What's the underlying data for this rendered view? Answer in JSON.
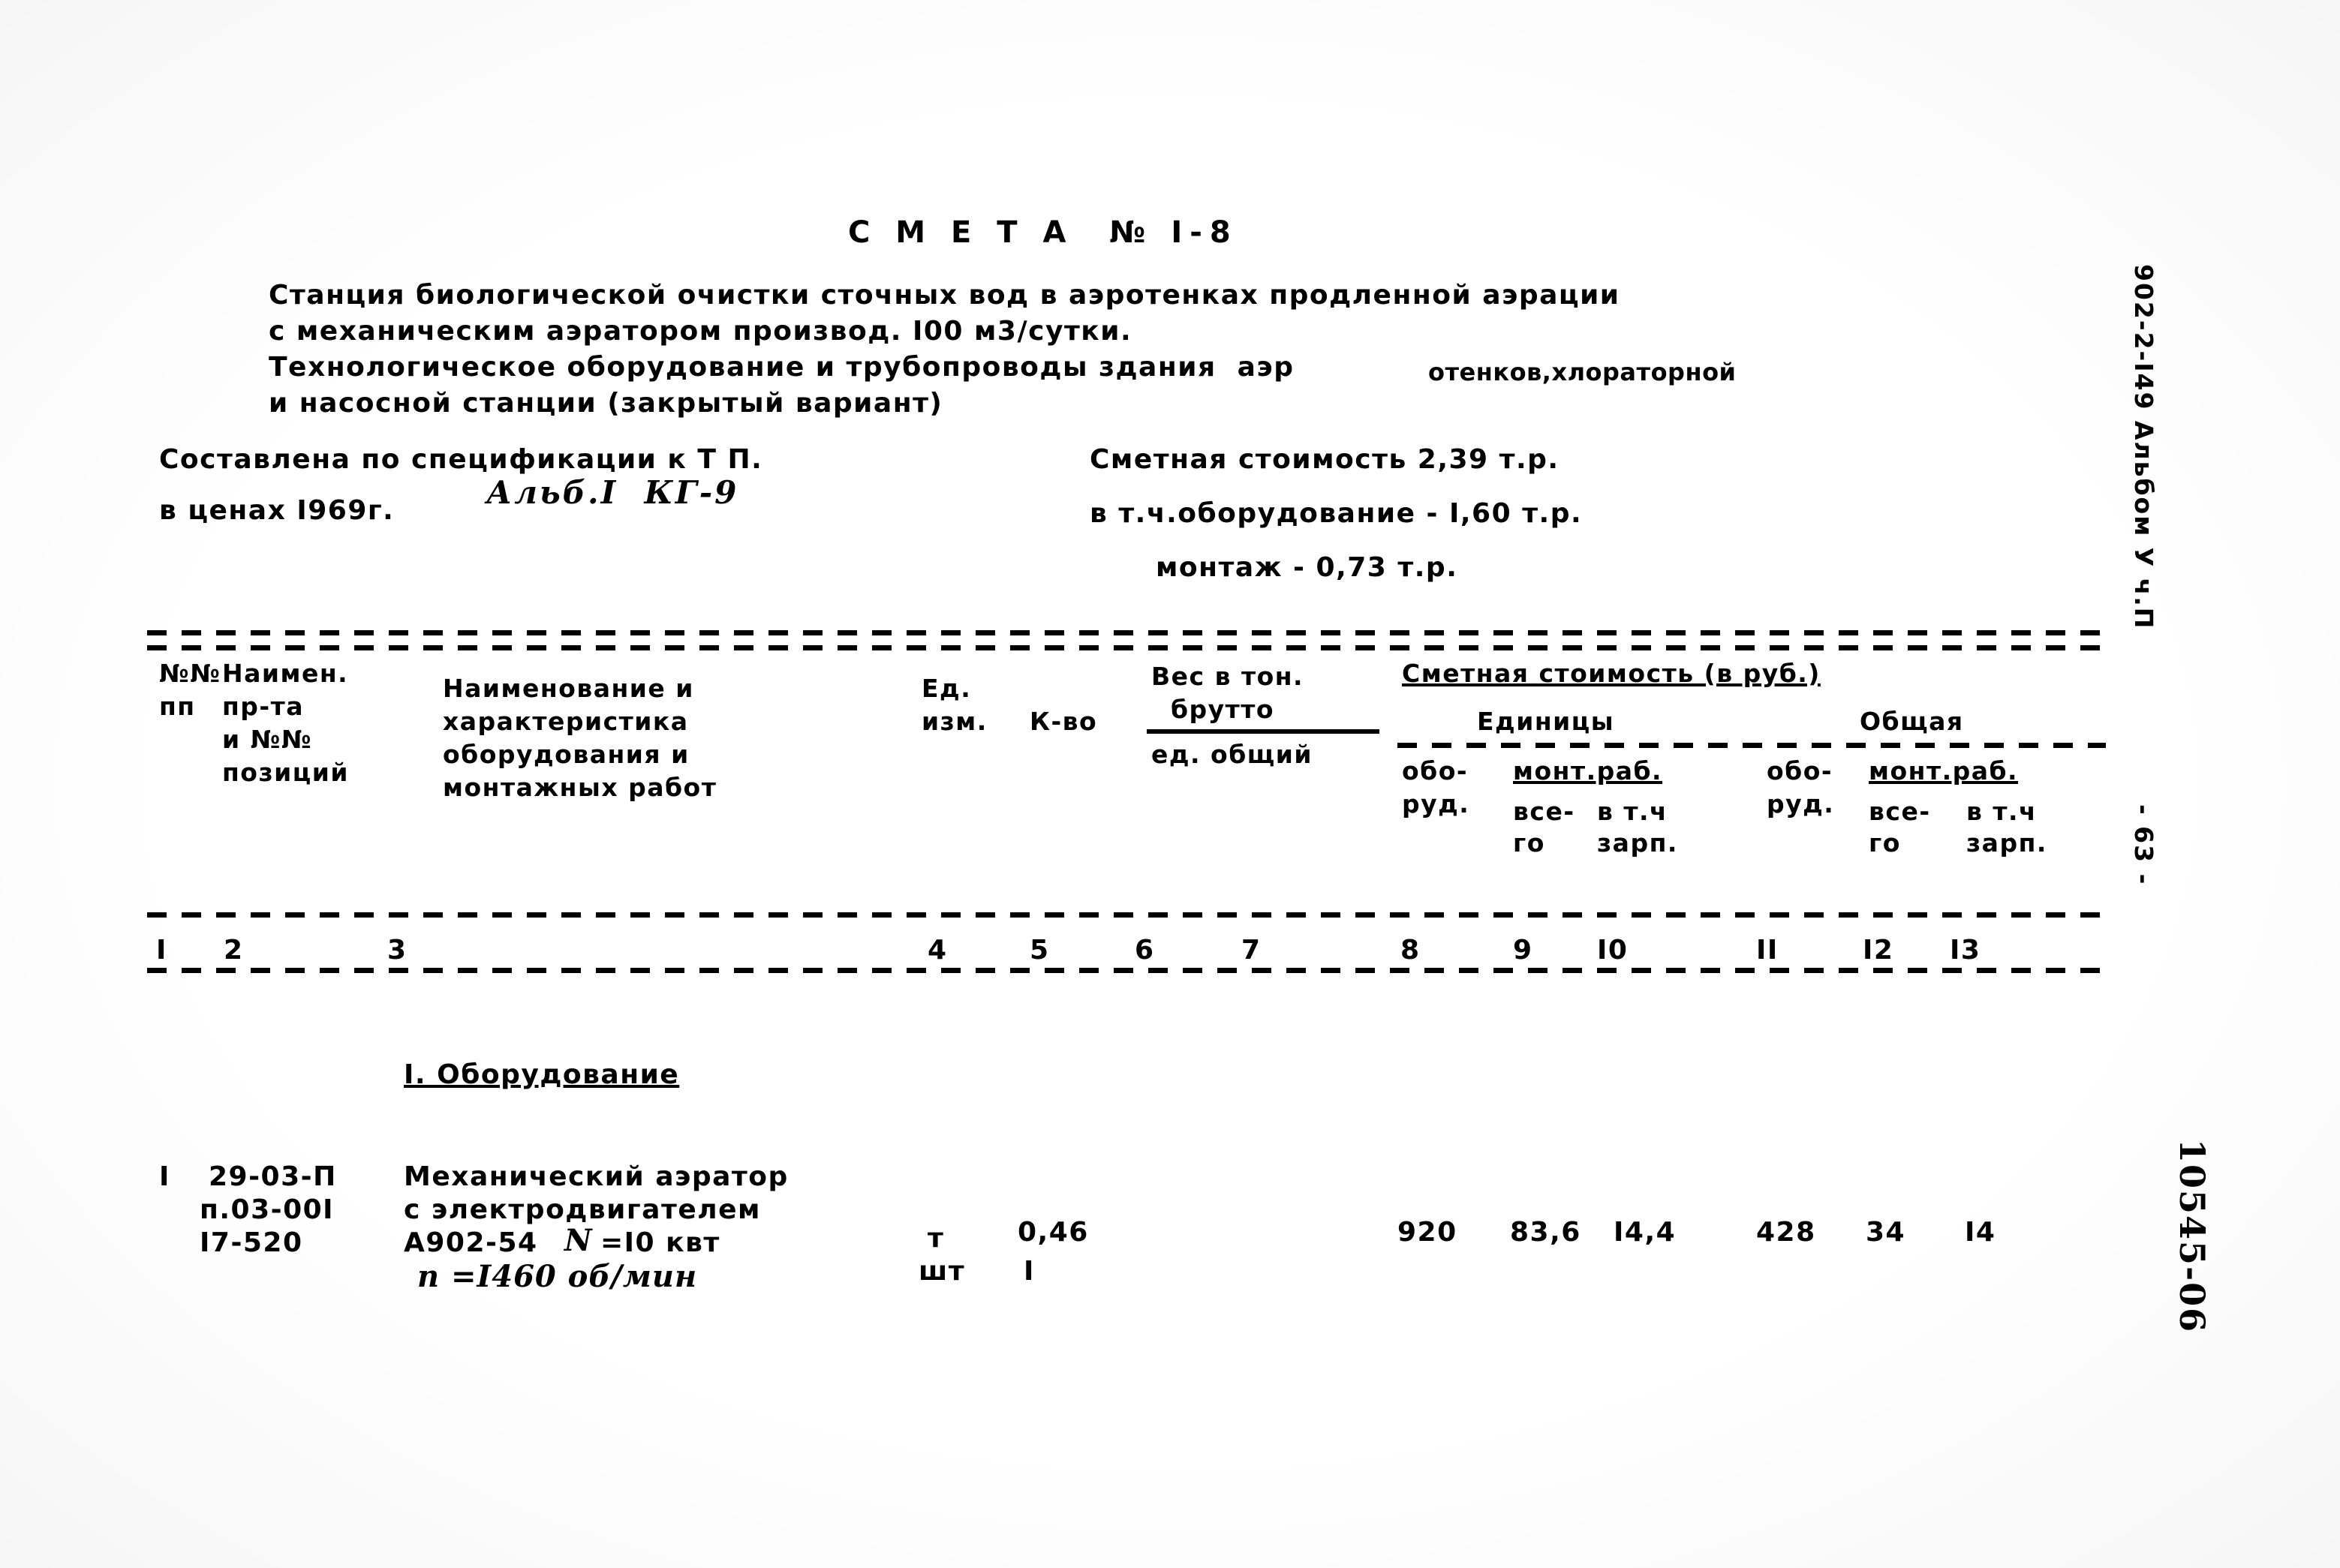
{
  "document": {
    "title": "С М Е Т А  № I-8",
    "description_lines": [
      "Станция биологической очистки сточных вод в аэротенках продленной аэрации",
      "с механическим аэратором производ. I00 м3/сутки.",
      "Технологическое оборудование и трубопроводы здания  аэр",
      "и насосной станции (закрытый вариант)"
    ],
    "description_overtype": "отенков,хлораторной",
    "compiled_label": "Составлена по спецификации к Т П.",
    "prices_label": "в ценах I969г.",
    "album_note": "Альб.I  КГ-9",
    "cost_total": "Сметная стоимость 2,39 т.р.",
    "cost_equipment": "в т.ч.оборудование - I,60 т.р.",
    "cost_installation": "монтаж - 0,73 т.р."
  },
  "margin": {
    "project_code": "902-2-I49 Альбом У ч.П",
    "page_number": "- 63 -",
    "archive_stamp": "10545-06"
  },
  "table": {
    "headers": {
      "col1_line1": "№№",
      "col1_line2": "пп",
      "col2_line1": "Наимен.",
      "col2_line2": "пр-та",
      "col2_line3": "и №№",
      "col2_line4": "позиций",
      "col3_line1": "Наименование и",
      "col3_line2": "характеристика",
      "col3_line3": "оборудования и",
      "col3_line4": "монтажных работ",
      "col4_line1": "Ед.",
      "col4_line2": "изм.",
      "col5": "К-во",
      "col6_line1": "Вес в тон.",
      "col6_line2": "брутто",
      "col6_line3": "ед. общий",
      "cost_group": "Сметная стоимость (в руб.)",
      "cost_unit": "Единицы",
      "cost_total": "Общая",
      "equip_line1": "обо-",
      "equip_line2": "руд.",
      "mont_title": "монт.раб.",
      "mont_line1": "все-",
      "mont_line2": "в т.ч",
      "mont_line3": "го",
      "mont_line4": "зарп."
    },
    "column_numbers": [
      "I",
      "2",
      "3",
      "4",
      "5",
      "6",
      "7",
      "8",
      "9",
      "I0",
      "II",
      "I2",
      "I3"
    ],
    "section_title": "I. Оборудование",
    "rows": [
      {
        "num": "I",
        "code_line1": "29-03-П",
        "code_line2": "п.03-00I",
        "code_line3": "I7-520",
        "name_line1": "Механический аэратор",
        "name_line2": "с электродвигателем",
        "name_line3": "А902-54",
        "name_line3_hand": "N",
        "name_line3_tail": "=I0 квт",
        "name_line4_hand": "n =I460 об/мин",
        "unit_line1": "т",
        "unit_line2": "шт",
        "qty_line1": "0,46",
        "qty_line2": "I",
        "unit_equip": "920",
        "unit_mont_all": "83,6",
        "unit_mont_zarp": "I4,4",
        "total_equip": "428",
        "total_mont_all": "34",
        "total_mont_zarp": "I4"
      }
    ]
  }
}
